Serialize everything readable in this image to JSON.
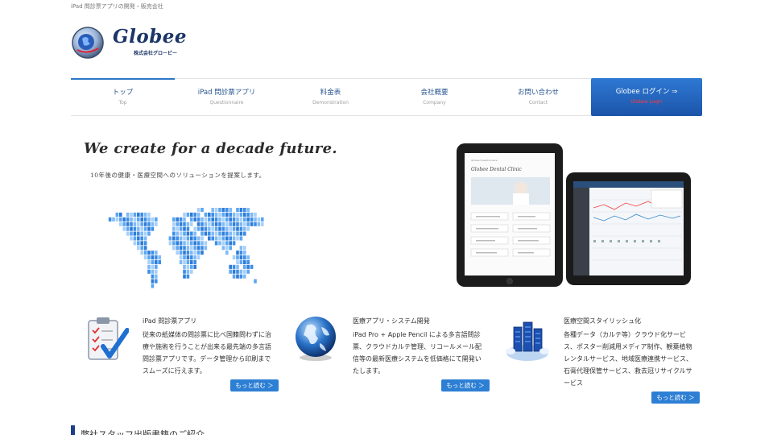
{
  "tagline": "iPad 問診票アプリの開発・販売会社",
  "logo": {
    "name": "Globee",
    "company": "株式会社グロービー"
  },
  "nav": {
    "items": [
      {
        "label": "トップ",
        "sub": "Top"
      },
      {
        "label": "iPad 問診票アプリ",
        "sub": "Questionnaire"
      },
      {
        "label": "料金表",
        "sub": "Demonstration"
      },
      {
        "label": "会社概要",
        "sub": "Company"
      },
      {
        "label": "お問い合わせ",
        "sub": "Contact"
      }
    ],
    "login": {
      "label": "Globee ログイン ⇒",
      "sub": "Globee Login"
    }
  },
  "hero": {
    "title": "We create for a decade future.",
    "subtitle": "10年後の健康・医療空間へのソリューションを提案します。"
  },
  "tablet": {
    "brand": "Globee Dental Clinic",
    "header_small": "Globee Questionnaire"
  },
  "features": [
    {
      "icon": "clipboard-check-icon",
      "title": "iPad 問診票アプリ",
      "lines": [
        "従来の紙媒体の問診票に比べ国籍問わずに治",
        "療や施術を行うことが出来る最先端の多言語",
        "問診票アプリです。データ管理から印刷まで",
        "スムーズに行えます。"
      ],
      "button": "もっと読む ＞"
    },
    {
      "icon": "globe-icon",
      "title": "医療アプリ・システム開発",
      "lines": [
        "iPad Pro + Apple Pencil による多言語問診",
        "票、クラウドカルテ管理、リコールメール配",
        "信等の最新医療システムを低価格にて開発い",
        "たします。"
      ],
      "button": "もっと読む ＞"
    },
    {
      "icon": "server-cloud-icon",
      "title": "医療空間スタイリッシュ化",
      "lines": [
        "各種データ（カルテ等）クラウド化サービ",
        "ス、ポスター削減用メディア制作、観葉植物",
        "レンタルサービス、地域医療連携サービス、",
        "石膏代理保管サービス、救去冠リサイクルサ",
        "ービス"
      ],
      "button": "もっと読む ＞"
    }
  ],
  "bottom_heading": "弊社スタッフ出版書籍のご紹介",
  "colors": {
    "primary": "#2d7fd4",
    "navy": "#1b3566"
  }
}
